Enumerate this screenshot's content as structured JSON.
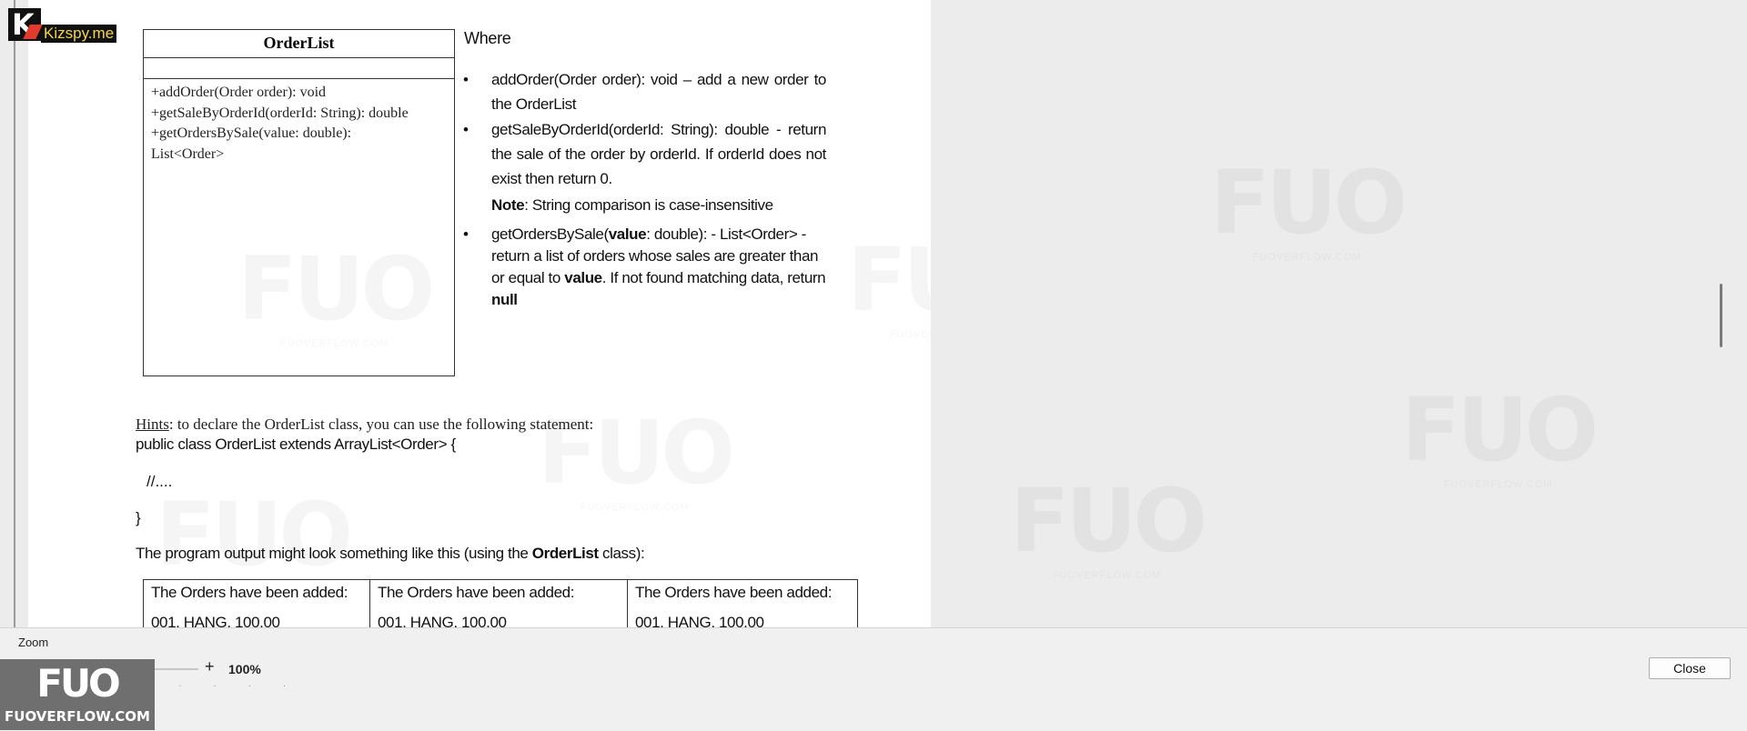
{
  "uml": {
    "class_name": "OrderList",
    "methods": [
      "+addOrder(Order order): void",
      "+getSaleByOrderId(orderId: String): double",
      "+getOrdersBySale(value: double):",
      "List<Order>"
    ]
  },
  "description": {
    "where": "Where",
    "b1": "addOrder(Order order): void – add a new order to the OrderList",
    "b2": "getSaleByOrderId(orderId: String): double - return the sale of the order by orderId. If orderId does not exist then return 0.",
    "note_label": "Note",
    "note_text": ": String comparison is case-insensitive",
    "b3_start": "getOrdersBySale(",
    "b3_value": "value",
    "b3_mid": ": double): - List<Order> - return a list of orders whose sales are greater than or equal to ",
    "b3_value2": "value",
    "b3_mid2": ". If not found matching data, return ",
    "b3_null": "null"
  },
  "hints": {
    "label": "Hints",
    "text": ": to declare the OrderList class, you can use the following statement:",
    "code_line1": "public class OrderList extends ArrayList<Order> {",
    "code_line2": "//....",
    "code_line3": "}",
    "output_intro_start": "The program output might look something like this (using the ",
    "output_intro_bold": "OrderList",
    "output_intro_end": " class):"
  },
  "output_table": {
    "cells": [
      {
        "line1": "The Orders have been added:",
        "line2": "001, HANG, 100.00"
      },
      {
        "line1": "The Orders have been added:",
        "line2": "001, HANG, 100.00"
      },
      {
        "line1": "The Orders have been added:",
        "line2": "001, HANG, 100.00"
      }
    ]
  },
  "toolbar": {
    "zoom_label": "Zoom",
    "minus": "-",
    "plus": "+",
    "zoom_value": "100%",
    "close_label": "Close"
  },
  "branding": {
    "kizspy": "Kizspy.me",
    "fuo_mark": "FUO",
    "fuo_text": "FUOVERFLOW.COM"
  },
  "watermark": {
    "mark": "FUO",
    "site": "FUOVERFLOW.COM"
  }
}
